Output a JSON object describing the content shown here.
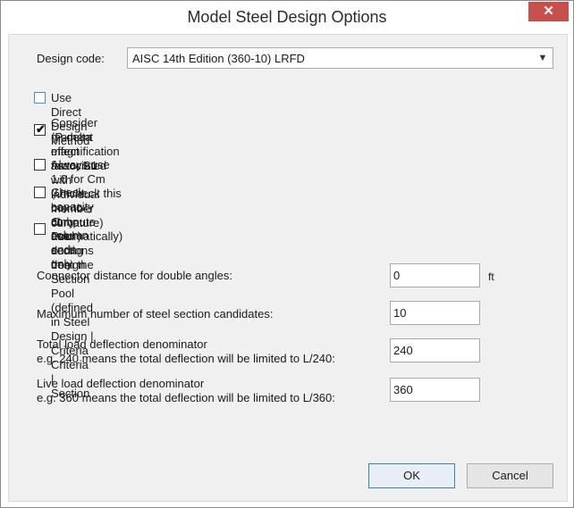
{
  "window": {
    "title": "Model Steel Design Options",
    "close_label": "✕"
  },
  "design_code": {
    "label": "Design code:",
    "selected": "AISC 14th Edition (360-10) LRFD"
  },
  "options": [
    {
      "line1": "Use Direct Design Method",
      "line2": "",
      "checked": false
    },
    {
      "line1": "Consider moment magnification factor B1",
      "line2": "(P-delta effect associated with individual member curvature)",
      "checked": true
    },
    {
      "line1": "Always use 1.0 for Cm (Uncheck this box to compute automatically)",
      "line2": "",
      "checked": false
    },
    {
      "line1": "Check capacity at column ends only",
      "line2": "",
      "checked": false
    },
    {
      "line1": "Only use sections from the Section Pool (defined in Steel Design | Criteria Criteria | Section",
      "line2": "Pool ) during design",
      "checked": false
    }
  ],
  "check_mark": "✔",
  "fields": {
    "connector": {
      "label": "Connector distance for double angles:",
      "value": "0",
      "unit": "ft"
    },
    "max_candidates": {
      "label": "Maximum number of steel section candidates:",
      "value": "10"
    },
    "total_deflection": {
      "label1": "Total load deflection denominator",
      "label2": "e.g. 240 means the total deflection will be limited to L/240:",
      "value": "240"
    },
    "live_deflection": {
      "label1": "Live load deflection denominator",
      "label2": "e.g. 360 means the total deflection will be limited to L/360:",
      "value": "360"
    }
  },
  "buttons": {
    "ok": "OK",
    "cancel": "Cancel"
  }
}
